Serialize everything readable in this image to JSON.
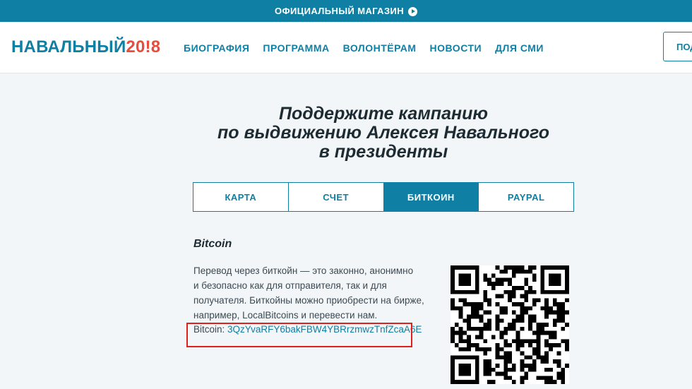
{
  "topbar": {
    "label": "ОФИЦИАЛЬНЫЙ МАГАЗИН",
    "icon": "play-circle-icon"
  },
  "header": {
    "logo_name": "НАВАЛЬНЫЙ",
    "logo_year": "20!8",
    "nav": [
      "БИОГРАФИЯ",
      "ПРОГРАММА",
      "ВОЛОНТЁРАМ",
      "НОВОСТИ",
      "ДЛЯ СМИ"
    ],
    "button_label": "ПОД"
  },
  "main": {
    "headline_lines": [
      "Поддержите кампанию",
      "по выдвижению Алексея Навального",
      "в президенты"
    ],
    "tabs": [
      {
        "label": "КАРТА",
        "active": false
      },
      {
        "label": "СЧЕТ",
        "active": false
      },
      {
        "label": "БИТКОИН",
        "active": true
      },
      {
        "label": "PAYPAL",
        "active": false
      }
    ],
    "section_title": "Bitcoin",
    "description_lines": [
      "Перевод через биткойн — это законно, анонимно",
      "и безопасно как для отправителя, так и для",
      "получателя. Биткойны можно приобрести на бирже,",
      "например, LocalBitcoins и перевести нам."
    ],
    "address_label": "Bitcoin:",
    "address_value": "3QzYvaRFY6bakFBW4YBRrzmwzTnfZcaA6E"
  },
  "colors": {
    "brand": "#0f7fa3",
    "accent": "#e94b3c",
    "highlight": "#e0201b"
  }
}
